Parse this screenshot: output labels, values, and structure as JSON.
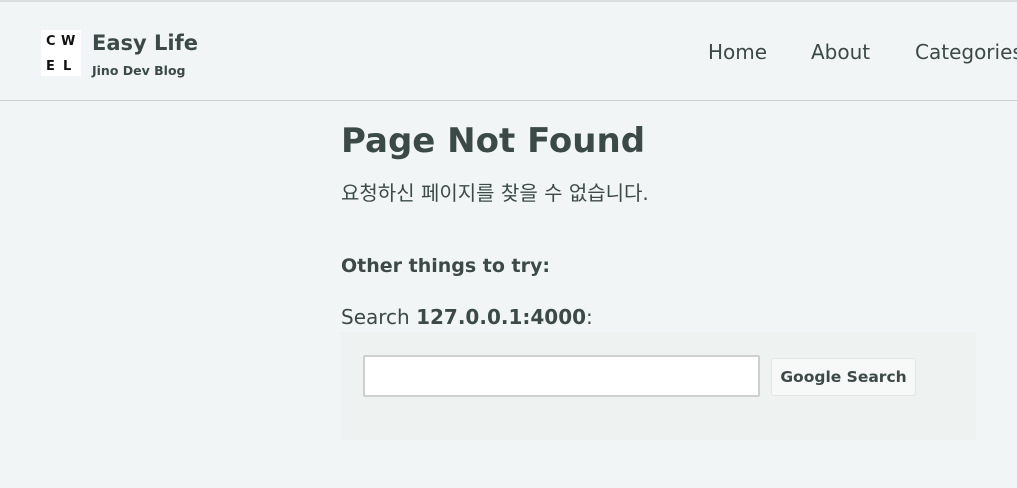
{
  "header": {
    "logo": {
      "letters": [
        "C",
        "W",
        "E",
        "L"
      ]
    },
    "brand_title": "Easy Life",
    "brand_subtitle": "Jino Dev Blog",
    "nav": [
      {
        "label": "Home"
      },
      {
        "label": "About"
      },
      {
        "label": "Categories"
      }
    ]
  },
  "main": {
    "title": "Page Not Found",
    "subtitle": "요청하신 페이지를 찾을 수 없습니다.",
    "other_heading": "Other things to try:",
    "search_prefix": "Search ",
    "search_host": "127.0.0.1:4000",
    "search_suffix": ":",
    "search_input": {
      "value": "",
      "placeholder": ""
    },
    "search_button_label": "Google Search"
  }
}
